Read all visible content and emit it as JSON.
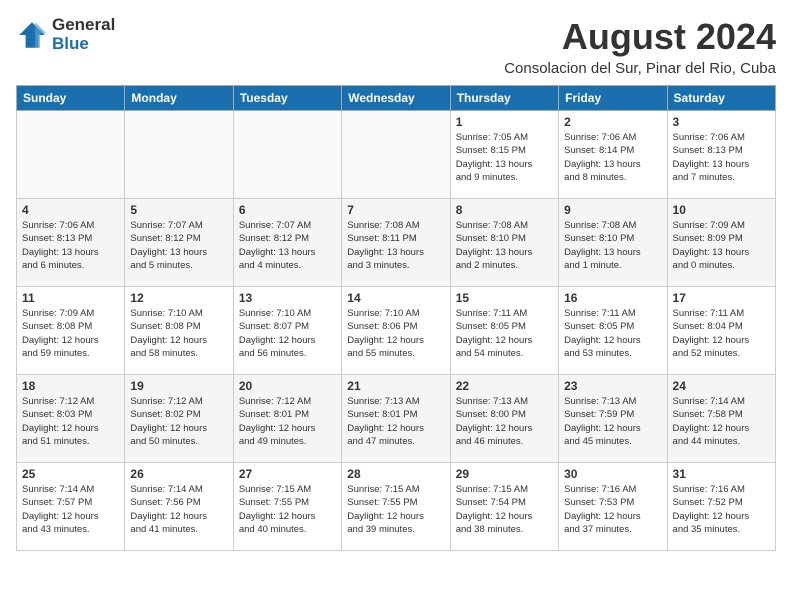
{
  "header": {
    "logo_general": "General",
    "logo_blue": "Blue",
    "title": "August 2024",
    "subtitle": "Consolacion del Sur, Pinar del Rio, Cuba"
  },
  "weekdays": [
    "Sunday",
    "Monday",
    "Tuesday",
    "Wednesday",
    "Thursday",
    "Friday",
    "Saturday"
  ],
  "weeks": [
    [
      {
        "day": "",
        "info": ""
      },
      {
        "day": "",
        "info": ""
      },
      {
        "day": "",
        "info": ""
      },
      {
        "day": "",
        "info": ""
      },
      {
        "day": "1",
        "info": "Sunrise: 7:05 AM\nSunset: 8:15 PM\nDaylight: 13 hours\nand 9 minutes."
      },
      {
        "day": "2",
        "info": "Sunrise: 7:06 AM\nSunset: 8:14 PM\nDaylight: 13 hours\nand 8 minutes."
      },
      {
        "day": "3",
        "info": "Sunrise: 7:06 AM\nSunset: 8:13 PM\nDaylight: 13 hours\nand 7 minutes."
      }
    ],
    [
      {
        "day": "4",
        "info": "Sunrise: 7:06 AM\nSunset: 8:13 PM\nDaylight: 13 hours\nand 6 minutes."
      },
      {
        "day": "5",
        "info": "Sunrise: 7:07 AM\nSunset: 8:12 PM\nDaylight: 13 hours\nand 5 minutes."
      },
      {
        "day": "6",
        "info": "Sunrise: 7:07 AM\nSunset: 8:12 PM\nDaylight: 13 hours\nand 4 minutes."
      },
      {
        "day": "7",
        "info": "Sunrise: 7:08 AM\nSunset: 8:11 PM\nDaylight: 13 hours\nand 3 minutes."
      },
      {
        "day": "8",
        "info": "Sunrise: 7:08 AM\nSunset: 8:10 PM\nDaylight: 13 hours\nand 2 minutes."
      },
      {
        "day": "9",
        "info": "Sunrise: 7:08 AM\nSunset: 8:10 PM\nDaylight: 13 hours\nand 1 minute."
      },
      {
        "day": "10",
        "info": "Sunrise: 7:09 AM\nSunset: 8:09 PM\nDaylight: 13 hours\nand 0 minutes."
      }
    ],
    [
      {
        "day": "11",
        "info": "Sunrise: 7:09 AM\nSunset: 8:08 PM\nDaylight: 12 hours\nand 59 minutes."
      },
      {
        "day": "12",
        "info": "Sunrise: 7:10 AM\nSunset: 8:08 PM\nDaylight: 12 hours\nand 58 minutes."
      },
      {
        "day": "13",
        "info": "Sunrise: 7:10 AM\nSunset: 8:07 PM\nDaylight: 12 hours\nand 56 minutes."
      },
      {
        "day": "14",
        "info": "Sunrise: 7:10 AM\nSunset: 8:06 PM\nDaylight: 12 hours\nand 55 minutes."
      },
      {
        "day": "15",
        "info": "Sunrise: 7:11 AM\nSunset: 8:05 PM\nDaylight: 12 hours\nand 54 minutes."
      },
      {
        "day": "16",
        "info": "Sunrise: 7:11 AM\nSunset: 8:05 PM\nDaylight: 12 hours\nand 53 minutes."
      },
      {
        "day": "17",
        "info": "Sunrise: 7:11 AM\nSunset: 8:04 PM\nDaylight: 12 hours\nand 52 minutes."
      }
    ],
    [
      {
        "day": "18",
        "info": "Sunrise: 7:12 AM\nSunset: 8:03 PM\nDaylight: 12 hours\nand 51 minutes."
      },
      {
        "day": "19",
        "info": "Sunrise: 7:12 AM\nSunset: 8:02 PM\nDaylight: 12 hours\nand 50 minutes."
      },
      {
        "day": "20",
        "info": "Sunrise: 7:12 AM\nSunset: 8:01 PM\nDaylight: 12 hours\nand 49 minutes."
      },
      {
        "day": "21",
        "info": "Sunrise: 7:13 AM\nSunset: 8:01 PM\nDaylight: 12 hours\nand 47 minutes."
      },
      {
        "day": "22",
        "info": "Sunrise: 7:13 AM\nSunset: 8:00 PM\nDaylight: 12 hours\nand 46 minutes."
      },
      {
        "day": "23",
        "info": "Sunrise: 7:13 AM\nSunset: 7:59 PM\nDaylight: 12 hours\nand 45 minutes."
      },
      {
        "day": "24",
        "info": "Sunrise: 7:14 AM\nSunset: 7:58 PM\nDaylight: 12 hours\nand 44 minutes."
      }
    ],
    [
      {
        "day": "25",
        "info": "Sunrise: 7:14 AM\nSunset: 7:57 PM\nDaylight: 12 hours\nand 43 minutes."
      },
      {
        "day": "26",
        "info": "Sunrise: 7:14 AM\nSunset: 7:56 PM\nDaylight: 12 hours\nand 41 minutes."
      },
      {
        "day": "27",
        "info": "Sunrise: 7:15 AM\nSunset: 7:55 PM\nDaylight: 12 hours\nand 40 minutes."
      },
      {
        "day": "28",
        "info": "Sunrise: 7:15 AM\nSunset: 7:55 PM\nDaylight: 12 hours\nand 39 minutes."
      },
      {
        "day": "29",
        "info": "Sunrise: 7:15 AM\nSunset: 7:54 PM\nDaylight: 12 hours\nand 38 minutes."
      },
      {
        "day": "30",
        "info": "Sunrise: 7:16 AM\nSunset: 7:53 PM\nDaylight: 12 hours\nand 37 minutes."
      },
      {
        "day": "31",
        "info": "Sunrise: 7:16 AM\nSunset: 7:52 PM\nDaylight: 12 hours\nand 35 minutes."
      }
    ]
  ]
}
